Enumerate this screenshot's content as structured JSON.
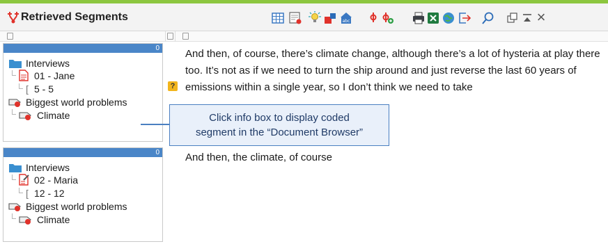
{
  "window": {
    "title": "Retrieved Segments"
  },
  "toolbar": {
    "icons": [
      "table-view-icon",
      "smart-coder-icon",
      "code-lightbulb-icon",
      "code-color-icon",
      "abc-words-icon",
      "code-icon",
      "code-add-icon",
      "print-icon",
      "excel-export-icon",
      "web-export-icon",
      "export-icon",
      "search-icon",
      "undock-icon",
      "minimize-icon",
      "close-icon"
    ],
    "close_glyph": "×",
    "help_glyph": "?"
  },
  "segments": [
    {
      "count": "0",
      "document_group": "Interviews",
      "document": "01 - Jane",
      "position": "5 - 5",
      "parent_code": "Biggest world problems",
      "code": "Climate",
      "text": "And then, of course, there’s climate change, although there’s a lot of hysteria at play there too. It’s not as if we need to turn the ship around and just reverse the last 60 years of emissions within a single year, so I don’t think we need to take"
    },
    {
      "count": "0",
      "document_group": "Interviews",
      "document": "02 - Maria",
      "position": "12 - 12",
      "parent_code": "Biggest world problems",
      "code": "Climate",
      "text": "And then, the climate, of course"
    }
  ],
  "callout": {
    "line1": "Click info box to display coded",
    "line2": "segment in the “Document Browser”"
  },
  "colors": {
    "accent": "#8cc63f",
    "infobox_header": "#4a86c8",
    "callout_border": "#4a7fc1",
    "code_red": "#e0322b",
    "help_badge": "#f2b51c"
  }
}
